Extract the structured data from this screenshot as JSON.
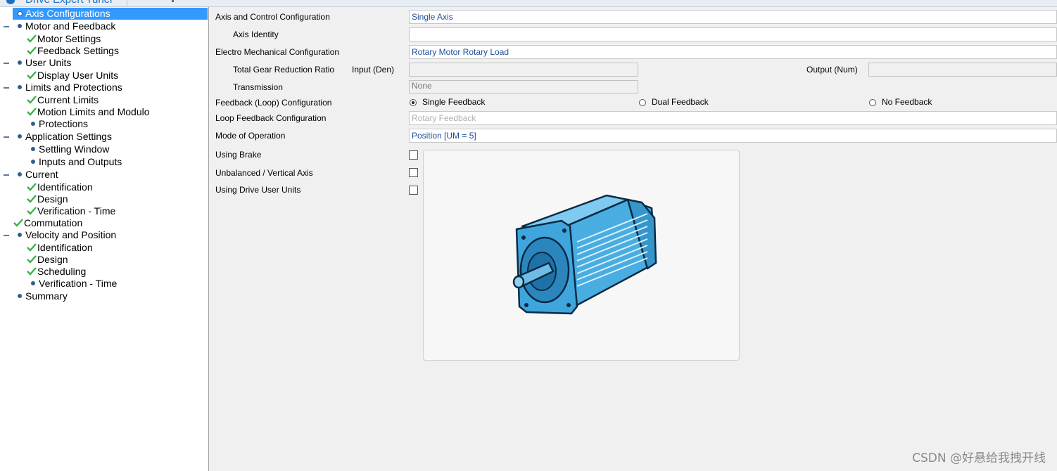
{
  "window": {
    "tab_title": "Drive Expert Tuner"
  },
  "tree": [
    {
      "label": "Axis Configurations",
      "selected": true
    },
    {
      "label": "Motor and Feedback"
    },
    {
      "label": "Motor Settings"
    },
    {
      "label": "Feedback Settings"
    },
    {
      "label": "User Units"
    },
    {
      "label": "Display User Units"
    },
    {
      "label": "Limits and Protections"
    },
    {
      "label": "Current Limits"
    },
    {
      "label": "Motion Limits and Modulo"
    },
    {
      "label": "Protections"
    },
    {
      "label": "Application Settings"
    },
    {
      "label": "Settling Window"
    },
    {
      "label": "Inputs and Outputs"
    },
    {
      "label": "Current"
    },
    {
      "label": "Identification"
    },
    {
      "label": "Design"
    },
    {
      "label": "Verification - Time"
    },
    {
      "label": "Commutation"
    },
    {
      "label": "Velocity and Position"
    },
    {
      "label": "Identification"
    },
    {
      "label": "Design"
    },
    {
      "label": "Scheduling"
    },
    {
      "label": "Verification - Time"
    },
    {
      "label": "Summary"
    }
  ],
  "form": {
    "axis_control_label": "Axis and Control Configuration",
    "axis_control_value": "Single Axis",
    "axis_identity_label": "Axis Identity",
    "axis_identity_value": "",
    "electro_label": "Electro Mechanical Configuration",
    "electro_value": "Rotary Motor Rotary Load",
    "gear_label": "Total Gear Reduction Ratio",
    "input_den_label": "Input (Den)",
    "input_den_value": "",
    "output_num_label": "Output (Num)",
    "output_num_value": "",
    "transmission_label": "Transmission",
    "transmission_value": "None",
    "feedback_loop_label": "Feedback (Loop) Configuration",
    "feedback_options": [
      "Single Feedback",
      "Dual Feedback",
      "No Feedback"
    ],
    "feedback_selected": "Single Feedback",
    "loop_feedback_label": "Loop Feedback Configuration",
    "loop_feedback_value": "Rotary Feedback",
    "mode_label": "Mode of Operation",
    "mode_value": "Position [UM = 5]",
    "brake_label": "Using Brake",
    "unbalanced_label": "Unbalanced / Vertical Axis",
    "user_units_label": "Using Drive User Units",
    "brake_checked": false,
    "unbalanced_checked": false,
    "user_units_checked": false
  },
  "watermark": "CSDN @好悬给我拽开线",
  "colors": {
    "selection": "#3399ff",
    "check": "#3bb04a",
    "link_text": "#1f4e9c",
    "motor": "#3ea6dc"
  }
}
